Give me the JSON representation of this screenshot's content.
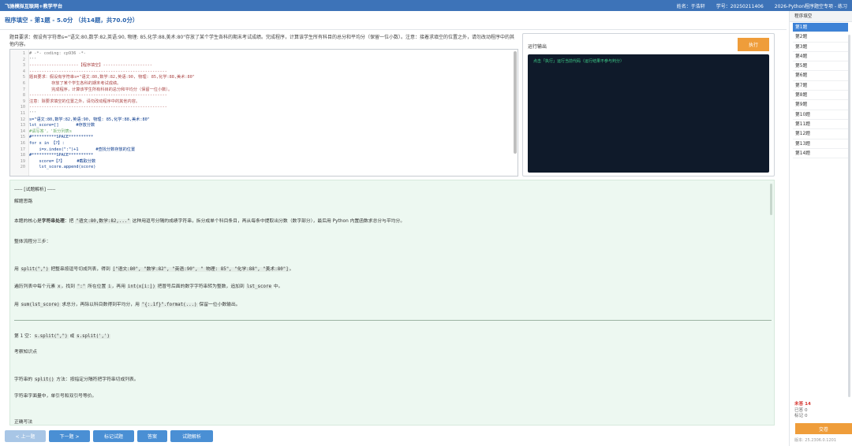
{
  "header": {
    "brand": "飞驰模拟互联网+教学平台",
    "name": "姓名：于浩轩",
    "student_id": "学号：20250211406",
    "course": "2026-Python程序题空专项 - 练习"
  },
  "question_header": "程序填空 - 第1题 - 5.0分 （共14题，共70.0分）",
  "question_text": "题目要求：假设有字符串s=\"语文:80,数学:82,英语:90, 物理: 85,化学:88,美术:80\"存放了某个学生各科的期末考试成绩。完成程序，计算该学生所有科目的总分和平均分（保留一位小数）。注意：接着求填空的位置之外，请勿改动程序中的其他内容。",
  "code_lines": [
    {
      "n": "1",
      "t": "# -*- coding: cp936 -*-",
      "c": "gray"
    },
    {
      "n": "2",
      "t": "'''",
      "c": "gray"
    },
    {
      "n": "3",
      "t": "--------------------【程序填空】--------------------",
      "c": "com"
    },
    {
      "n": "4",
      "t": "--------------------------------------------------------",
      "c": "com"
    },
    {
      "n": "5",
      "t": "题目要求：假设有字符串s=\"语文:80,数学:82,英语:90, 物理: 85,化学:88,美术:80\"",
      "c": "com"
    },
    {
      "n": "6",
      "t": "         存放了某个学生各科的期末考试成绩。",
      "c": "com"
    },
    {
      "n": "7",
      "t": "         完成程序，计算该学生所有科目的总分和平均分（保留一位小数）。",
      "c": "com"
    },
    {
      "n": "8",
      "t": "--------------------------------------------------------",
      "c": "com"
    },
    {
      "n": "9",
      "t": "注意：除要求填空的位置之外，请勿改动程序中的其他内容。",
      "c": "com"
    },
    {
      "n": "10",
      "t": "--------------------------------------------------------",
      "c": "com"
    },
    {
      "n": "11",
      "t": "'''",
      "c": "gray"
    },
    {
      "n": "12",
      "t": "s=\"语文:80,数学:82,英语:90, 物理: 85,化学:88,美术:80\"",
      "c": "key"
    },
    {
      "n": "13",
      "t": "lst_score=[]       #存放分数",
      "c": "key"
    },
    {
      "n": "14",
      "t": "#请写答'，'拆分列表s",
      "c": "grn"
    },
    {
      "n": "15",
      "t": "#**********SPACE**********",
      "c": "key"
    },
    {
      "n": "16",
      "t": "for x in 【?】:",
      "c": "key"
    },
    {
      "n": "17",
      "t": "    i=x.index(\":\")+1       #查找分数存放的位置",
      "c": "key"
    },
    {
      "n": "18",
      "t": "#**********SPACE**********",
      "c": "key"
    },
    {
      "n": "19",
      "t": "    score=【?】     #截取分数",
      "c": "key"
    },
    {
      "n": "20",
      "t": "    lst_score.append(score)",
      "c": "key"
    }
  ],
  "run_panel": {
    "title": "运行输出",
    "run_label": "执行",
    "console_text": "点击「执行」运行当前代码（运行结果不参与判分）"
  },
  "analysis": {
    "header": "----- [试题解析] -----",
    "section1": "解题思路",
    "p1_pre": "本题的核心是",
    "p1_bold": "字符串处理",
    "p1_mid": "：把 ",
    "p1_code": "\"语文:80,数学:82,...\"",
    "p1_post": " 这种用逗号分隔的成绩字符串，拆分成单个科目条目，再从每条中提取出分数（数字部分），最后用 Python 内置函数求总分与平均分。",
    "p2": "整体流程分三步：",
    "s1_pre": "用 ",
    "s1_code1": "split(\",\")",
    "s1_mid": " 把整串按逗号切成列表，得到 ",
    "s1_code2": "[\"语文:80\", \"数学:82\", \"英语:90\", \" 物理: 85\", \"化学:88\", \"美术:80\"]",
    "s1_post": "。",
    "s2_pre": "遍历列表中每个元素 ",
    "s2_code1": "x",
    "s2_mid1": "，找到 ",
    "s2_code2": "\":\"",
    "s2_mid2": " 所在位置 ",
    "s2_code3": "i",
    "s2_mid3": "，再用 ",
    "s2_code4": "int(x[i:])",
    "s2_mid4": " 把冒号后面的数字字符串转为整数，追加到 ",
    "s2_code5": "lst_score",
    "s2_post": " 中。",
    "s3_pre": "用 ",
    "s3_code1": "sum(lst_score)",
    "s3_mid": " 求总分，再除以科目数得到平均分，用 ",
    "s3_code2": "\"{:.1f}\".format(...)",
    "s3_post": " 保留一位小数输出。",
    "blank1_pre": "第 1 空：",
    "blank1_code1": "s.split(\",\")",
    "blank1_mid": " 或 ",
    "blank1_code2": "s.split(',')",
    "kp": "考察知识点",
    "kp1_pre": "字符串的 ",
    "kp1_code": "split()",
    "kp1_post": " 方法：按指定分隔符把字符串切成列表。",
    "kp2": "字符串字面量中，单引号和双引号等价。",
    "correct": "正确写法"
  },
  "bottom_buttons": {
    "prev": "< 上一题",
    "next": "下一题 >",
    "mark": "标记试题",
    "answer": "答案",
    "analysis": "试题解析"
  },
  "sidebar": {
    "title": "程序填空",
    "items": [
      "第1题",
      "第2题",
      "第3题",
      "第4题",
      "第5题",
      "第6题",
      "第7题",
      "第8题",
      "第9题",
      "第10题",
      "第11题",
      "第12题",
      "第13题",
      "第14题"
    ],
    "unanswered": "未答 14",
    "answered": "已答 0",
    "marked": "标记 0",
    "submit": "交卷",
    "version": "版本: 25.2306.0.1201"
  }
}
